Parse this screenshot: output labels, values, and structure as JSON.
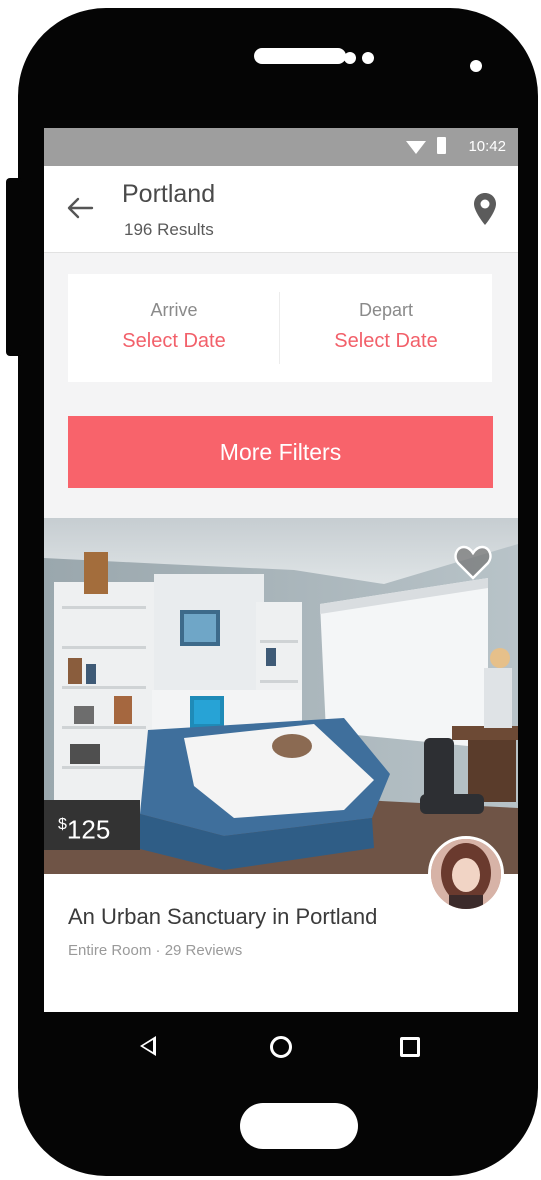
{
  "status_bar": {
    "time": "10:42",
    "icons": [
      "wifi-icon",
      "battery-icon"
    ]
  },
  "header": {
    "title": "Portland",
    "subtitle": "196 Results",
    "back_icon": "arrow-left-icon",
    "location_icon": "map-pin-icon"
  },
  "dates": {
    "arrive_label": "Arrive",
    "arrive_value": "Select Date",
    "depart_label": "Depart",
    "depart_value": "Select Date"
  },
  "filters_button": "More Filters",
  "listing": {
    "price_symbol": "$",
    "price_amount": "125",
    "title": "An Urban Sanctuary in Portland",
    "meta": "Entire Room · 29 Reviews",
    "favorite_icon": "heart-icon"
  },
  "nav_bar": {
    "icons": [
      "back-triangle-icon",
      "home-circle-icon",
      "recents-square-icon"
    ]
  },
  "colors": {
    "accent": "#f8636b",
    "accent_text": "#f2606a",
    "status_bar": "#9e9e9e",
    "phone_frame": "#050505"
  }
}
